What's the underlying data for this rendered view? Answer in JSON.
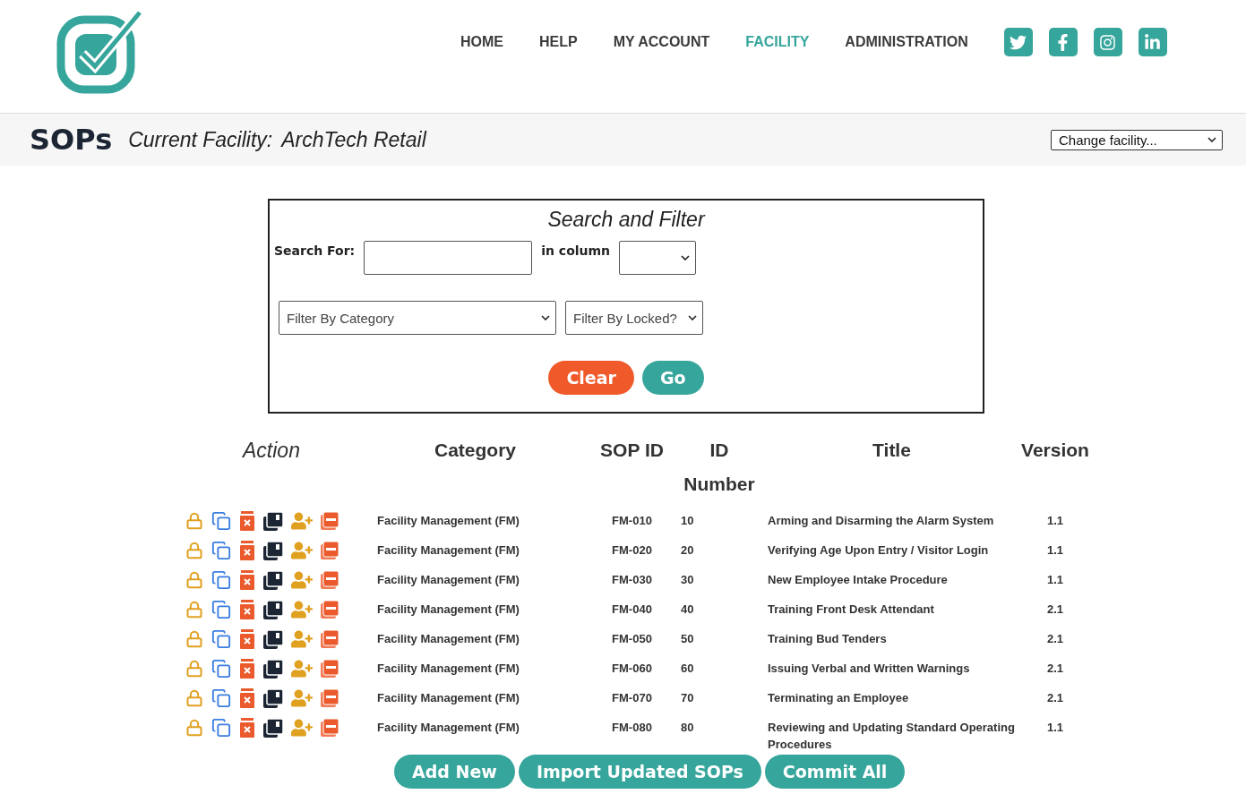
{
  "nav": [
    {
      "label": "HOME",
      "selected": false
    },
    {
      "label": "HELP",
      "selected": false
    },
    {
      "label": "MY ACCOUNT",
      "selected": false
    },
    {
      "label": "FACILITY",
      "selected": true
    },
    {
      "label": "ADMINISTRATION",
      "selected": false
    }
  ],
  "page": {
    "title": "SOPs",
    "facility_label": "Current Facility:",
    "facility_name": "ArchTech Retail",
    "facility_select": "Change facility..."
  },
  "filter": {
    "title": "Search and Filter",
    "search_label": "Search For:",
    "column_label": "in column",
    "category_select": "Filter By Category",
    "locked_select": "Filter By Locked?",
    "clear": "Clear",
    "go": "Go"
  },
  "table": {
    "columns": [
      "Action",
      "Category",
      "SOP ID",
      "ID Number",
      "Title",
      "Version"
    ],
    "rows": [
      {
        "category": "Facility Management (FM)",
        "sop_id": "FM-010",
        "id": "10",
        "title": "Arming and Disarming the Alarm System",
        "version": "1.1"
      },
      {
        "category": "Facility Management (FM)",
        "sop_id": "FM-020",
        "id": "20",
        "title": "Verifying Age Upon Entry / Visitor Login",
        "version": "1.1"
      },
      {
        "category": "Facility Management (FM)",
        "sop_id": "FM-030",
        "id": "30",
        "title": "New Employee Intake Procedure",
        "version": "1.1"
      },
      {
        "category": "Facility Management (FM)",
        "sop_id": "FM-040",
        "id": "40",
        "title": "Training Front Desk Attendant",
        "version": "2.1"
      },
      {
        "category": "Facility Management (FM)",
        "sop_id": "FM-050",
        "id": "50",
        "title": "Training Bud Tenders",
        "version": "2.1"
      },
      {
        "category": "Facility Management (FM)",
        "sop_id": "FM-060",
        "id": "60",
        "title": "Issuing Verbal and Written Warnings",
        "version": "2.1"
      },
      {
        "category": "Facility Management (FM)",
        "sop_id": "FM-070",
        "id": "70",
        "title": "Terminating an Employee",
        "version": "2.1"
      },
      {
        "category": "Facility Management (FM)",
        "sop_id": "FM-080",
        "id": "80",
        "title": "Reviewing and Updating Standard Operating Procedures",
        "version": "1.1"
      }
    ]
  },
  "buttons": [
    "Add New",
    "Import Updated SOPs",
    "Commit All"
  ]
}
